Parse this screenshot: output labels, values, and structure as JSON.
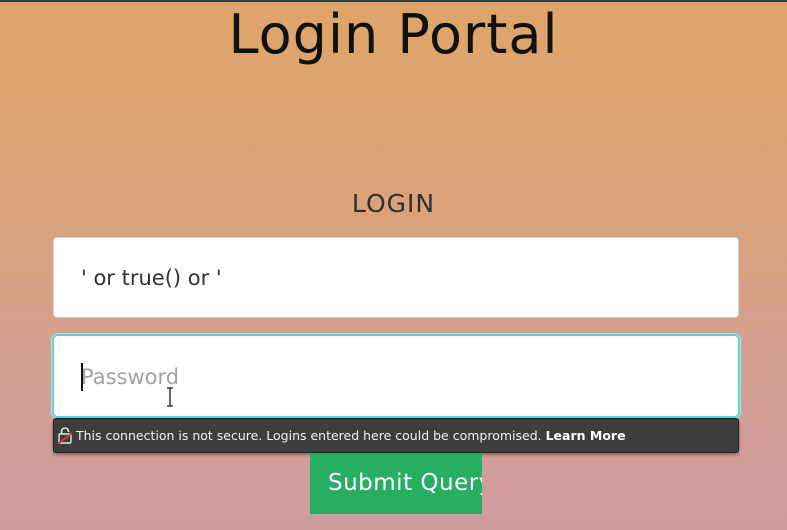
{
  "page": {
    "title": "Login Portal"
  },
  "form": {
    "heading": "LOGIN",
    "username_value": "' or true() or '",
    "password_placeholder": "Password",
    "submit_label": "Submit Query"
  },
  "security_warning": {
    "message": "This connection is not secure. Logins entered here could be compromised.",
    "link_label": "Learn More",
    "icon": "broken-lock-icon"
  },
  "colors": {
    "accent_focus": "#5fd3d8",
    "submit_button": "#27ae60",
    "warning_background": "#3e3e3e",
    "lock_icon": "#c0392b"
  }
}
